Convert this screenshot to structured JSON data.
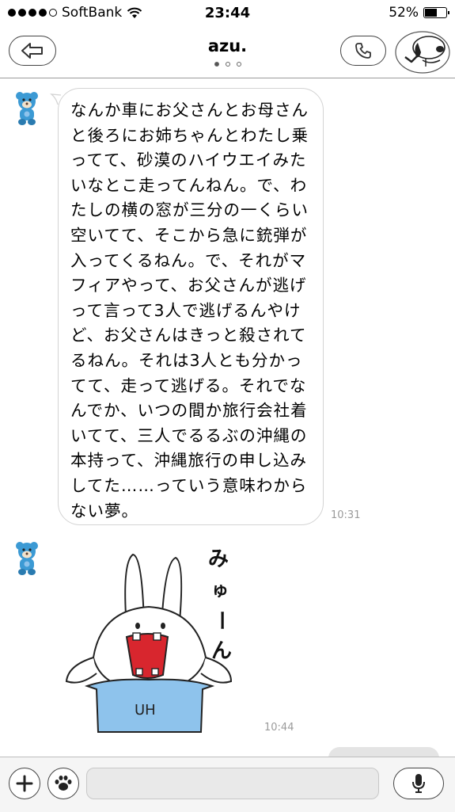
{
  "status_bar": {
    "carrier": "SoftBank",
    "time": "23:44",
    "battery_percent": "52%",
    "signal_bars": 4,
    "battery_level": 0.52,
    "wifi_icon": "wifi-icon"
  },
  "header": {
    "title": "azu.",
    "page_indicator": {
      "count": 3,
      "active": 0
    }
  },
  "messages": [
    {
      "sender": "azu.",
      "text": "なんか車にお父さんとお母さんと後ろにお姉ちゃんとわたし乗ってて、砂漠のハイウエイみたいなとこ走ってんねん。で、わたしの横の窓が三分の一くらい空いてて、そこから急に銃弾が入ってくるねん。で、それがマフィアやって、お父さんが逃げって言って3人で逃げるんやけど、お父さんはきっと殺されてるねん。それは3人とも分かってて、走って逃げる。それでなんでか、いつの間か旅行会社着いてて、三人でるるぶの沖縄の本持って、沖縄旅行の申し込みしてた……っていう意味わからない夢。",
      "time": "10:31"
    },
    {
      "sender": "azu.",
      "sticker": {
        "text": "みゅーん",
        "shirt_text": "UH"
      },
      "time": "10:44"
    }
  ],
  "colors": {
    "sticker_shirt": "#8ec3ec",
    "sticker_mouth": "#d8262e",
    "avatar_bear": "#3c9ad4"
  }
}
